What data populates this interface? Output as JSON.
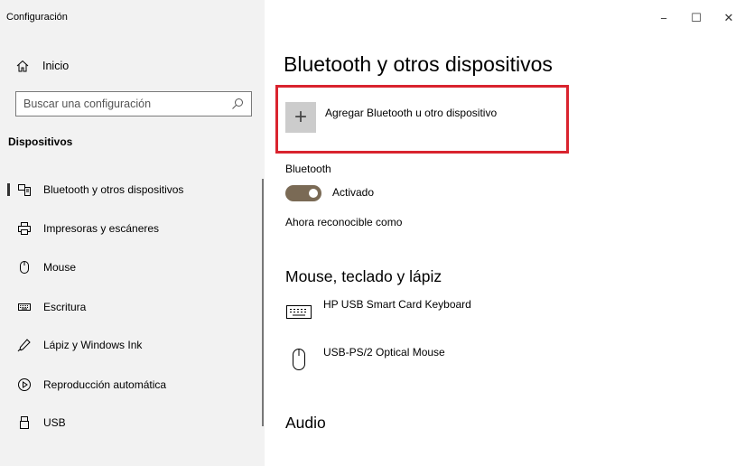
{
  "app": {
    "title": "Configuración"
  },
  "window": {
    "minimize": "−",
    "maximize": "☐",
    "close": "✕"
  },
  "sidebar": {
    "home_label": "Inicio",
    "search_placeholder": "Buscar una configuración",
    "section_title": "Dispositivos",
    "items": [
      {
        "label": "Bluetooth y otros dispositivos",
        "icon": "bluetooth-devices-icon",
        "active": true
      },
      {
        "label": "Impresoras y escáneres",
        "icon": "printer-icon",
        "active": false
      },
      {
        "label": "Mouse",
        "icon": "mouse-icon",
        "active": false
      },
      {
        "label": "Escritura",
        "icon": "keyboard-icon",
        "active": false
      },
      {
        "label": "Lápiz y Windows Ink",
        "icon": "pen-icon",
        "active": false
      },
      {
        "label": "Reproducción automática",
        "icon": "autoplay-icon",
        "active": false
      },
      {
        "label": "USB",
        "icon": "usb-icon",
        "active": false
      }
    ]
  },
  "main": {
    "title": "Bluetooth y otros dispositivos",
    "add_device_label": "Agregar Bluetooth u otro dispositivo",
    "add_device_icon": "+",
    "bluetooth_label": "Bluetooth",
    "bluetooth_state": "Activado",
    "discoverable_text": "Ahora reconocible como",
    "section_input": "Mouse, teclado y lápiz",
    "devices": [
      {
        "name": "HP USB Smart Card Keyboard",
        "icon": "keyboard-icon"
      },
      {
        "name": "USB-PS/2 Optical Mouse",
        "icon": "mouse-icon"
      }
    ],
    "section_audio": "Audio"
  },
  "colors": {
    "highlight": "#d9232e",
    "toggle_on": "#7a6a55",
    "sidebar_bg": "#f2f2f2"
  }
}
